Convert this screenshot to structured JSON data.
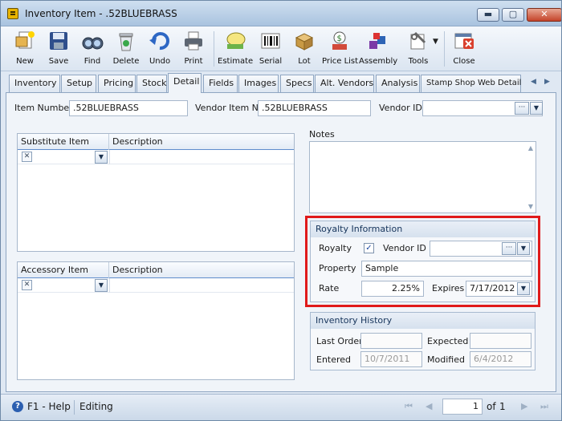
{
  "window": {
    "title": "Inventory Item - .52BLUEBRASS",
    "minimize_glyph": "▬",
    "maximize_glyph": "▢",
    "close_glyph": "✕"
  },
  "toolbar": {
    "items": [
      {
        "label": "New",
        "icon": "new-icon"
      },
      {
        "label": "Save",
        "icon": "save-icon"
      },
      {
        "label": "Find",
        "icon": "find-icon"
      },
      {
        "label": "Delete",
        "icon": "delete-icon"
      },
      {
        "label": "Undo",
        "icon": "undo-icon"
      },
      {
        "label": "Print",
        "icon": "print-icon"
      },
      {
        "label": "Estimate",
        "icon": "estimate-icon"
      },
      {
        "label": "Serial",
        "icon": "serial-icon"
      },
      {
        "label": "Lot",
        "icon": "lot-icon"
      },
      {
        "label": "Price List",
        "icon": "price-list-icon"
      },
      {
        "label": "Assembly",
        "icon": "assembly-icon"
      },
      {
        "label": "Tools",
        "icon": "tools-icon"
      },
      {
        "label": "Close",
        "icon": "close-icon"
      }
    ]
  },
  "tabs": {
    "items": [
      "Inventory",
      "Setup",
      "Pricing",
      "Stock",
      "Detail",
      "Fields",
      "Images",
      "Specs",
      "Alt. Vendors",
      "Analysis",
      "Stamp Shop Web Detail"
    ],
    "active": "Detail",
    "prev_glyph": "◀",
    "next_glyph": "▶"
  },
  "header": {
    "item_number_label": "Item Number",
    "item_number_value": ".52BLUEBRASS",
    "vendor_item_no_label": "Vendor Item No",
    "vendor_item_no_value": ".52BLUEBRASS",
    "vendor_id_label": "Vendor ID",
    "vendor_id_value": ""
  },
  "substitute_grid": {
    "columns": [
      "Substitute Item",
      "Description"
    ]
  },
  "accessory_grid": {
    "columns": [
      "Accessory Item",
      "Description"
    ]
  },
  "notes": {
    "label": "Notes",
    "value": ""
  },
  "royalty": {
    "title": "Royalty Information",
    "royalty_label": "Royalty",
    "royalty_checked": true,
    "vendor_id_label": "Vendor ID",
    "vendor_id_value": "",
    "property_label": "Property",
    "property_value": "Sample",
    "rate_label": "Rate",
    "rate_value": "2.25%",
    "expires_label": "Expires",
    "expires_value": "7/17/2012",
    "highlight_color": "#e01a1a"
  },
  "inventory_history": {
    "title": "Inventory History",
    "last_order_label": "Last Order",
    "last_order_value": "",
    "expected_label": "Expected",
    "expected_value": "",
    "entered_label": "Entered",
    "entered_value": "10/7/2011",
    "modified_label": "Modified",
    "modified_value": "6/4/2012"
  },
  "statusbar": {
    "help": "F1 - Help",
    "mode": "Editing",
    "page_value": "1",
    "of_label": "of",
    "page_count": "1"
  },
  "glyphs": {
    "check": "✓",
    "x": "✕",
    "dropdown": "▼",
    "dots": "···",
    "up": "▲",
    "down": "▼",
    "first": "⏮",
    "prev": "◀",
    "next": "▶",
    "last": "⏭",
    "help": "?"
  }
}
